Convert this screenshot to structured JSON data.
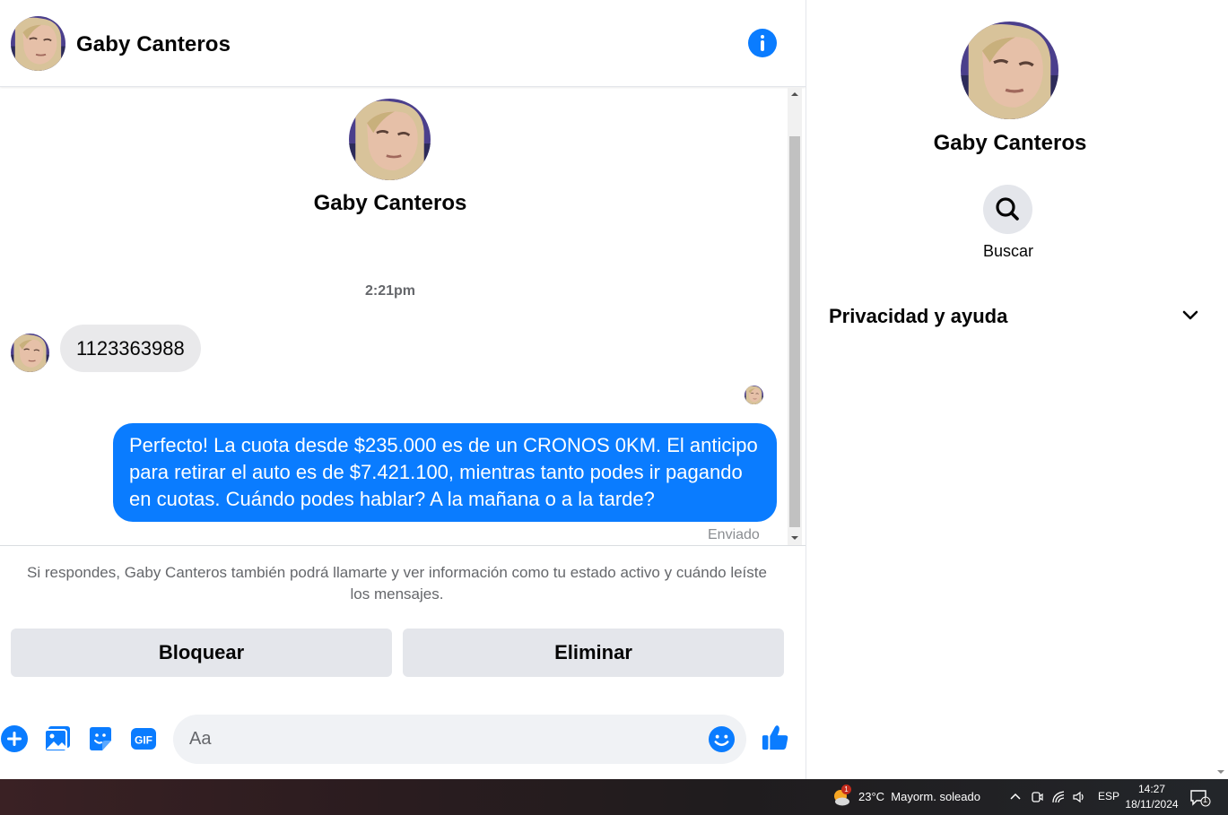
{
  "contact": {
    "name": "Gaby Canteros"
  },
  "header": {
    "name": "Gaby Canteros"
  },
  "conversation": {
    "intro_name": "Gaby Canteros",
    "timestamp": "2:21pm",
    "incoming": {
      "text": "1123363988"
    },
    "outgoing": {
      "text": "Perfecto! La cuota desde $235.000 es de un CRONOS 0KM. El anticipo para retirar el auto es de $7.421.100, mientras tanto podes ir pagando en cuotas. Cuándo podes hablar? A la mañana o a la tarde?"
    },
    "status": "Enviado"
  },
  "request": {
    "notice": "Si respondes, Gaby Canteros también podrá llamarte y ver información como tu estado activo y cuándo leíste los mensajes.",
    "block_label": "Bloquear",
    "delete_label": "Eliminar"
  },
  "composer": {
    "placeholder": "Aa",
    "icons": [
      "plus-icon",
      "photo-icon",
      "sticker-icon",
      "gif-icon",
      "emoji-icon",
      "like-icon"
    ]
  },
  "details": {
    "name": "Gaby Canteros",
    "search_label": "Buscar",
    "privacy_label": "Privacidad y ayuda"
  },
  "taskbar": {
    "weather": "23°C  Mayorm. soleado",
    "weather_badge": "1",
    "language": "ESP",
    "time": "14:27",
    "date": "18/11/2024",
    "notification_count": "1"
  },
  "colors": {
    "accent": "#0a7cff",
    "bubble_in": "#e9e9eb",
    "button_bg": "#e4e6eb"
  }
}
